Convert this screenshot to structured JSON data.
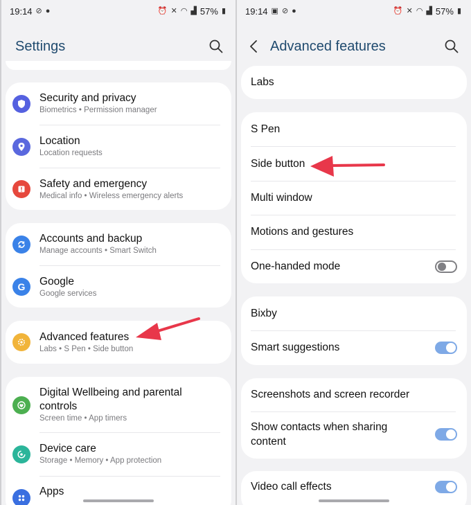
{
  "left": {
    "status": {
      "time": "19:14",
      "battery": "57%"
    },
    "title": "Settings",
    "groups": [
      {
        "items": [
          {
            "title": "Security and privacy",
            "subtitle": "Biometrics  •  Permission manager",
            "icon": "shield-icon",
            "color": "#5561e0"
          },
          {
            "title": "Location",
            "subtitle": "Location requests",
            "icon": "location-pin-icon",
            "color": "#5a68de"
          },
          {
            "title": "Safety and emergency",
            "subtitle": "Medical info  •  Wireless emergency alerts",
            "icon": "alert-icon",
            "color": "#e6483d"
          }
        ]
      },
      {
        "items": [
          {
            "title": "Accounts and backup",
            "subtitle": "Manage accounts  •  Smart Switch",
            "icon": "sync-icon",
            "color": "#3a82e8"
          },
          {
            "title": "Google",
            "subtitle": "Google services",
            "icon": "google-icon",
            "color": "#3a82e8"
          }
        ]
      },
      {
        "items": [
          {
            "title": "Advanced features",
            "subtitle": "Labs  •  S Pen  •  Side button",
            "icon": "star-gear-icon",
            "color": "#f1b43a"
          }
        ]
      },
      {
        "items": [
          {
            "title_line1": "Digital Wellbeing and parental",
            "title_line2": "controls",
            "subtitle": "Screen time  •  App timers",
            "icon": "wellbeing-icon",
            "color": "#4caf50"
          },
          {
            "title": "Device care",
            "subtitle": "Storage  •  Memory  •  App protection",
            "icon": "device-care-icon",
            "color": "#2bb59a"
          },
          {
            "title": "Apps",
            "icon": "apps-icon",
            "color": "#3a6fe0"
          }
        ]
      }
    ]
  },
  "right": {
    "status": {
      "time": "19:14",
      "battery": "57%"
    },
    "title": "Advanced features",
    "items": {
      "labs": "Labs",
      "spen": "S Pen",
      "side_button": "Side button",
      "multi_window": "Multi window",
      "motions": "Motions and gestures",
      "one_handed": {
        "label": "One-handed mode",
        "on": false
      },
      "bixby": "Bixby",
      "smart_suggestions": {
        "label": "Smart suggestions",
        "on": true
      },
      "screenshots": "Screenshots and screen recorder",
      "show_contacts": {
        "label_line1": "Show contacts when sharing",
        "label_line2": "content",
        "on": true
      },
      "video_call": {
        "label": "Video call effects",
        "on": true
      }
    }
  },
  "colors": {
    "accent_arrow": "#e8374a",
    "header_text": "#1f4a6e",
    "toggle_on": "#7ea9e6"
  }
}
